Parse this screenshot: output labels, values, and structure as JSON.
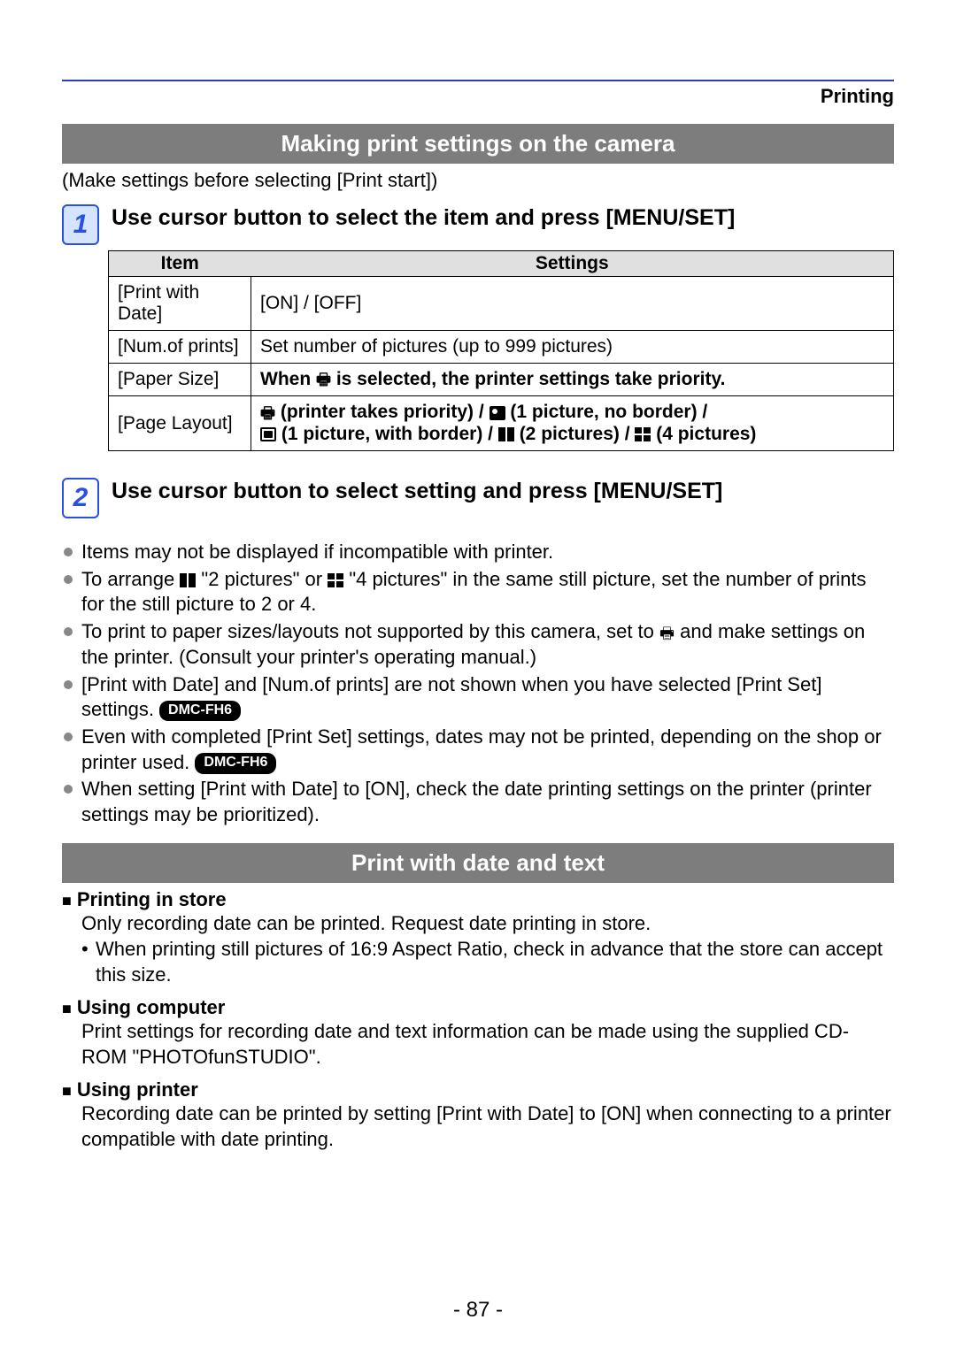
{
  "page_category": "Printing",
  "section1_title": "Making print settings on the camera",
  "intro": "(Make settings before selecting [Print start])",
  "step1": {
    "num": "1",
    "title": "Use cursor button to select the item and press [MENU/SET]"
  },
  "table": {
    "head_item": "Item",
    "head_settings": "Settings",
    "rows": [
      {
        "item": "[Print with Date]",
        "settings_plain": "[ON] / [OFF]"
      },
      {
        "item": "[Num.of prints]",
        "settings_plain": "Set number of pictures (up to 999 pictures)"
      },
      {
        "item": "[Paper Size]",
        "settings_bold_pre": "When ",
        "settings_bold_post": " is selected, the printer settings take priority."
      },
      {
        "item": "[Page Layout]",
        "layout": {
          "printer_priority": " (printer takes priority) / ",
          "p1_noborder": " (1 picture, no border) /",
          "p1_border": " (1 picture, with border) / ",
          "p2": " (2 pictures) / ",
          "p4": " (4 pictures)"
        }
      }
    ]
  },
  "step2": {
    "num": "2",
    "title": "Use cursor button to select setting and press [MENU/SET]"
  },
  "bullets": {
    "b1": "Items may not be displayed if incompatible with printer.",
    "b2a": "To arrange ",
    "b2b": " \"2 pictures\" or ",
    "b2c": " \"4 pictures\" in the same still picture, set the number of prints for the still picture to 2 or 4.",
    "b3a": "To print to paper sizes/layouts not supported by this camera, set to ",
    "b3b": " and make settings on the printer. (Consult your printer's operating manual.)",
    "b4a": "[Print with Date] and [Num.of prints] are not shown when you have selected [Print Set] settings. ",
    "b5a": "Even with completed [Print Set] settings, dates may not be printed, depending on the shop or printer used. ",
    "b6": "When setting [Print with Date] to [ON], check the date printing settings on the printer (printer settings may be prioritized).",
    "badge": "DMC-FH6"
  },
  "section2_title": "Print with date and text",
  "sub": {
    "s1_head": "Printing in store",
    "s1_text": "Only recording date can be printed. Request date printing in store.",
    "s1_dash": "When printing still pictures of 16:9 Aspect Ratio, check in advance that the store can accept this size.",
    "s2_head": "Using computer",
    "s2_text": "Print settings for recording date and text information can be made using the supplied CD-ROM \"PHOTOfunSTUDIO\".",
    "s3_head": "Using printer",
    "s3_text": "Recording date can be printed by setting [Print with Date] to [ON] when connecting to a printer compatible with date printing."
  },
  "page_number": "- 87 -"
}
